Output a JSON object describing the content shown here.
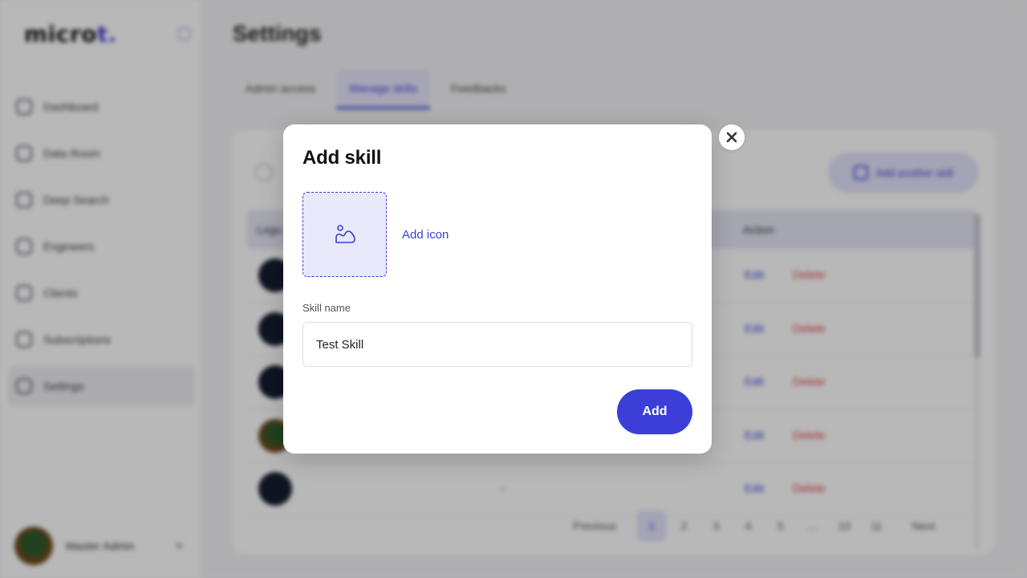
{
  "brand": {
    "logo_text": "micro",
    "logo_dot": "t."
  },
  "sidebar": {
    "items": [
      {
        "label": "Dashboard",
        "icon": "dashboard-icon"
      },
      {
        "label": "Data Room",
        "icon": "chart-icon"
      },
      {
        "label": "Deep Search",
        "icon": "search-icon"
      },
      {
        "label": "Engineers",
        "icon": "engineer-icon"
      },
      {
        "label": "Clients",
        "icon": "clients-icon"
      },
      {
        "label": "Subscriptions",
        "icon": "subscriptions-icon"
      },
      {
        "label": "Settings",
        "icon": "settings-icon",
        "active": true
      }
    ],
    "user": {
      "name": "Master Admin",
      "more": "«"
    }
  },
  "main": {
    "title": "Settings",
    "tabs": [
      {
        "label": "Admin access"
      },
      {
        "label": "Manage skills",
        "active": true
      },
      {
        "label": "Feedbacks"
      }
    ],
    "add_another_label": "Add another skill",
    "table": {
      "headers": {
        "logo": "Logo",
        "action": "Action"
      },
      "rows": [
        {
          "edit": "Edit",
          "delete": "Delete",
          "col": ""
        },
        {
          "edit": "Edit",
          "delete": "Delete",
          "col": ""
        },
        {
          "edit": "Edit",
          "delete": "Delete",
          "col": ""
        },
        {
          "edit": "Edit",
          "delete": "Delete",
          "col": ""
        },
        {
          "edit": "Edit",
          "delete": "Delete",
          "col": "-"
        }
      ]
    },
    "pagination": {
      "prev": "Previous",
      "pages": [
        "1",
        "2",
        "3",
        "4",
        "5",
        "...",
        "10",
        "11"
      ],
      "next": "Next",
      "current": "1"
    }
  },
  "modal": {
    "title": "Add skill",
    "add_icon_label": "Add icon",
    "field_label": "Skill name",
    "field_value": "Test Skill",
    "submit_label": "Add",
    "accent": "#3b3fd8"
  }
}
